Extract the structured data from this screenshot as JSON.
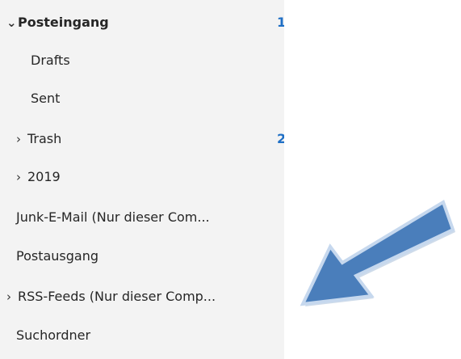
{
  "folders": [
    {
      "label": "Posteingang",
      "chevron": "⌄",
      "count": "1"
    },
    {
      "label": "Drafts"
    },
    {
      "label": "Sent"
    },
    {
      "label": "Trash",
      "chevron": "›",
      "count": "2"
    },
    {
      "label": "2019",
      "chevron": "›"
    },
    {
      "label": "Junk-E-Mail (Nur dieser Com..."
    },
    {
      "label": "Postausgang"
    },
    {
      "label": "RSS-Feeds (Nur dieser Comp...",
      "chevron": "›"
    },
    {
      "label": "Suchordner"
    }
  ],
  "colors": {
    "pane_bg": "#f3f3f3",
    "count": "#1f6fc5",
    "arrow_fill": "#4a7ebb",
    "arrow_outline": "#c6d8ee"
  },
  "icons": {
    "expanded": "chevron-down-icon",
    "collapsed": "chevron-right-icon",
    "annotation": "arrow-annotation-icon"
  }
}
